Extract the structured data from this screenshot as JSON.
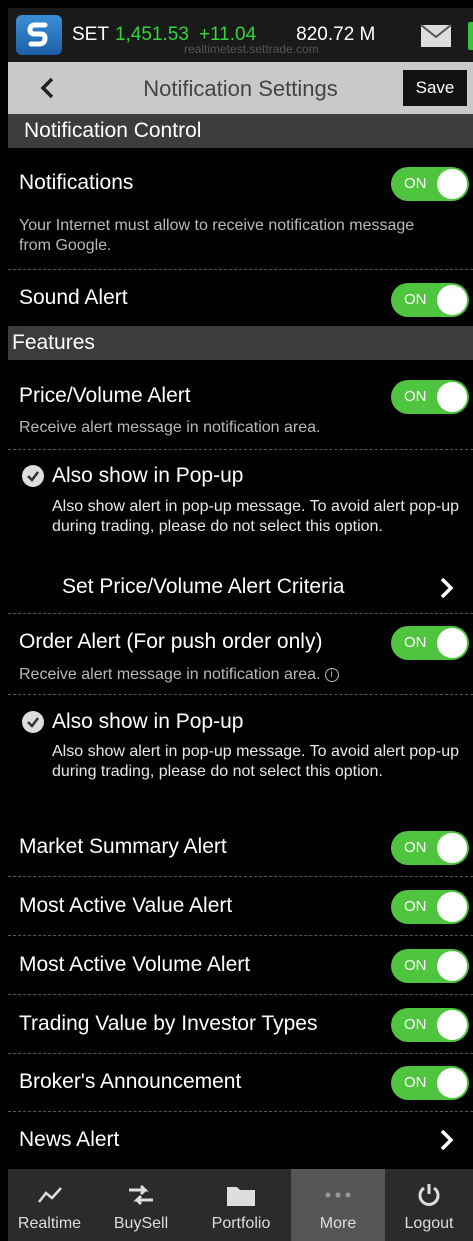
{
  "status_bar": {
    "index_label": "SET",
    "index_value": "1,451.53",
    "index_change": "+11.04",
    "volume": "820.72 M",
    "host": "realtimetest.settrade.com",
    "accent_up": "#35d43b"
  },
  "header": {
    "title": "Notification Settings",
    "save_label": "Save"
  },
  "sections": {
    "control": "Notification Control",
    "features": "Features"
  },
  "toggle_on_label": "ON",
  "rows": {
    "notifications": {
      "label": "Notifications",
      "desc": "Your Internet must allow to receive notification message from Google.",
      "on": true
    },
    "sound_alert": {
      "label": "Sound Alert",
      "on": true
    },
    "price_volume": {
      "label": "Price/Volume Alert",
      "desc": "Receive alert message in notification area.",
      "on": true
    },
    "pv_popup": {
      "label": "Also show in Pop-up",
      "desc": "Also show alert in pop-up message. To avoid alert pop-up during trading, please do not select this option.",
      "checked": true
    },
    "pv_criteria": {
      "label": "Set Price/Volume Alert Criteria"
    },
    "order_alert": {
      "label": "Order Alert (For push order only)",
      "desc": "Receive alert message in notification area.",
      "on": true
    },
    "order_popup": {
      "label": "Also show in Pop-up",
      "desc": "Also show alert in pop-up message. To avoid alert pop-up during trading, please do not select this option.",
      "checked": true
    },
    "market_summary": {
      "label": "Market Summary Alert",
      "on": true
    },
    "most_active_value": {
      "label": "Most Active Value Alert",
      "on": true
    },
    "most_active_volume": {
      "label": "Most Active Volume Alert",
      "on": true
    },
    "trading_value": {
      "label": "Trading Value by Investor Types",
      "on": true
    },
    "broker_announcement": {
      "label": "Broker's Announcement",
      "on": true
    },
    "news_alert": {
      "label": "News Alert"
    }
  },
  "bottom_nav": {
    "realtime": "Realtime",
    "buysell": "BuySell",
    "portfolio": "Portfolio",
    "more": "More",
    "logout": "Logout"
  },
  "colors": {
    "toggle_on": "#4fc43e",
    "header_bg": "#c9c9c9",
    "section_bg": "#3c3c3c"
  }
}
